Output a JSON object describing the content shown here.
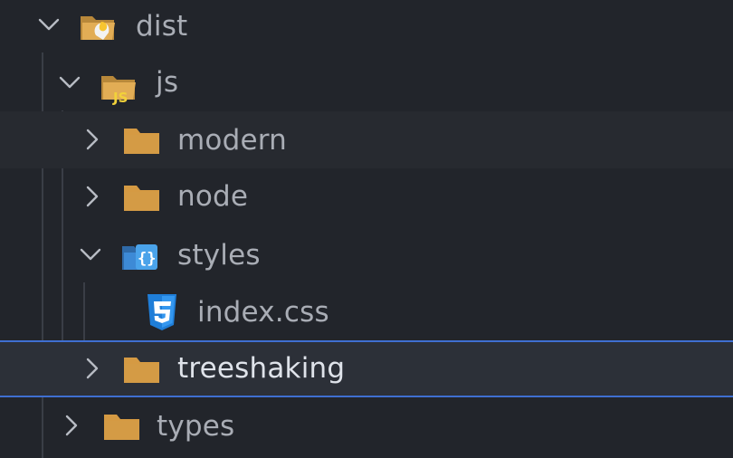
{
  "explorer": {
    "items": [
      {
        "label": "dist",
        "state": "expanded",
        "icon": "folder-dist-open-icon"
      },
      {
        "label": "js",
        "state": "expanded",
        "icon": "folder-js-open-icon"
      },
      {
        "label": "modern",
        "state": "collapsed",
        "icon": "folder-icon"
      },
      {
        "label": "node",
        "state": "collapsed",
        "icon": "folder-icon"
      },
      {
        "label": "styles",
        "state": "expanded",
        "icon": "folder-css-open-icon"
      },
      {
        "label": "index.css",
        "state": "file",
        "icon": "css3-file-icon"
      },
      {
        "label": "treeshaking",
        "state": "collapsed",
        "icon": "folder-icon",
        "selected": true
      },
      {
        "label": "types",
        "state": "collapsed",
        "icon": "folder-icon"
      }
    ]
  },
  "colors": {
    "background": "#22252b",
    "selection_border": "#3f6fd1",
    "folder": "#d59a43",
    "css_icon": "#1f7ed8",
    "label": "#a9adb5"
  }
}
